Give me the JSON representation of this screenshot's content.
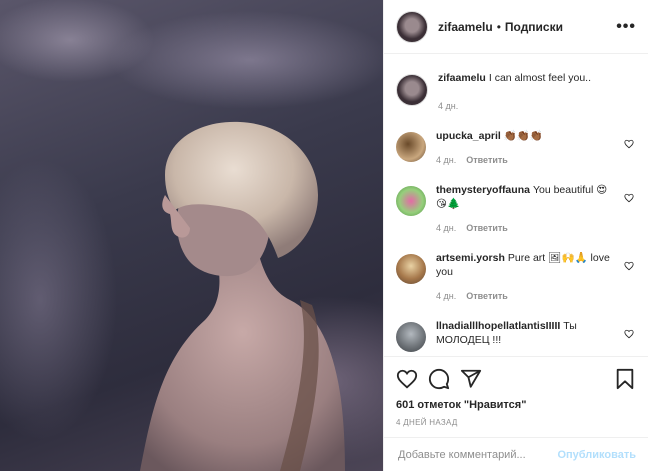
{
  "post": {
    "username": "zifaamelu",
    "separator": "•",
    "follow_label": "Подписки",
    "more_label": "•••",
    "caption_text": "I can almost feel you..",
    "caption_time": "4 дн."
  },
  "comments": [
    {
      "user": "upucka_april",
      "text": "👏🏾👏🏾👏🏾",
      "time": "4 дн.",
      "reply": "Ответить"
    },
    {
      "user": "themysteryoffauna",
      "text": "You beautiful 😍😘🌲",
      "time": "4 дн.",
      "reply": "Ответить"
    },
    {
      "user": "artsemi.yorsh",
      "text": "Pure art 🖼🙌🙏 love you",
      "time": "4 дн.",
      "reply": "Ответить"
    },
    {
      "user": "llnadialllhopellatlantisIIIII",
      "text": "Ты МОЛОДЕЦ !!!",
      "time": "",
      "reply": ""
    }
  ],
  "actions": {
    "likes_count": "601 отметок",
    "likes_suffix": "\"Нравится\"",
    "time_ago": "4 ДНЕЙ НАЗАД"
  },
  "add_comment": {
    "placeholder": "Добавьте комментарий...",
    "post_label": "Опубликовать"
  },
  "colors": {
    "link_disabled": "#b2dffc",
    "muted": "#8e8e8e",
    "text": "#262626"
  },
  "icons": [
    "heart-icon",
    "comment-icon",
    "share-icon",
    "bookmark-icon",
    "more-icon"
  ]
}
